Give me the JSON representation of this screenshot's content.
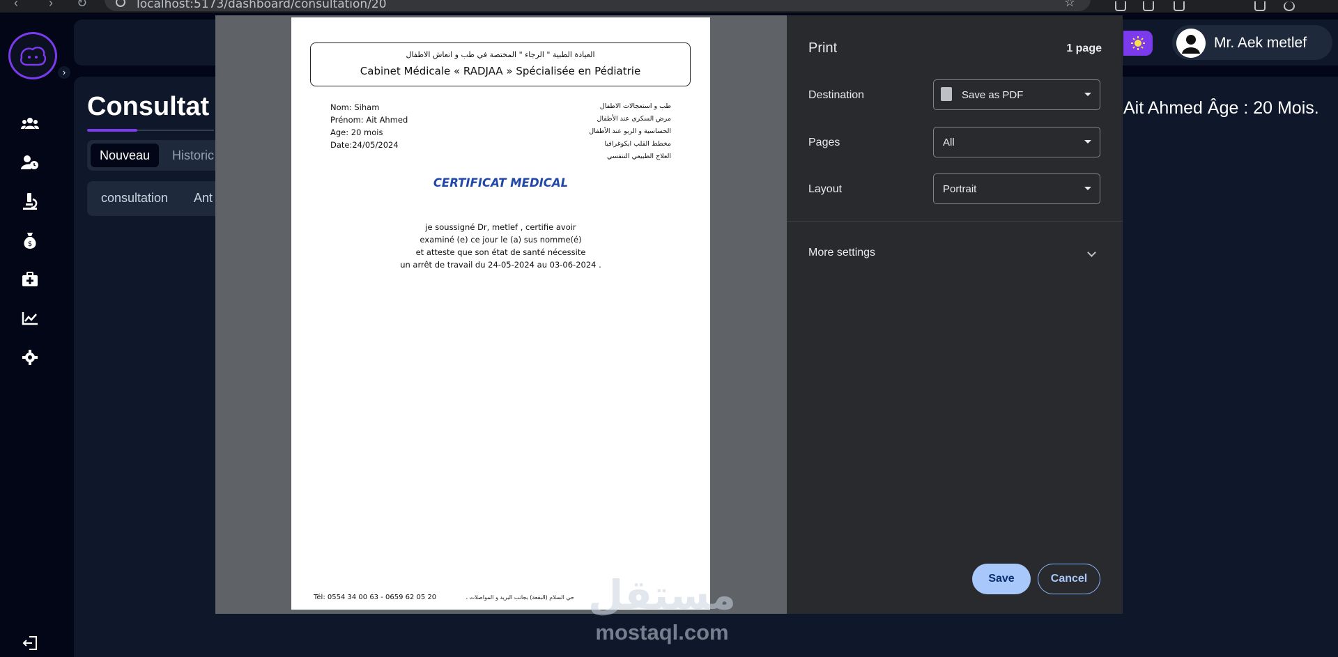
{
  "browser": {
    "url": "localhost:5173/dashboard/consultation/20"
  },
  "app": {
    "user_name": "Mr. Aek metlef",
    "page_title": "Consultat",
    "tabs": [
      "Nouveau",
      "Historic"
    ],
    "subtabs": [
      "consultation",
      "Ant"
    ],
    "patient_info": "Ait Ahmed Âge : 20 Mois.",
    "nav_icons": [
      "patients-icon",
      "user-clock-icon",
      "microscope-icon",
      "money-bag-icon",
      "medical-kit-icon",
      "chart-line-icon",
      "gear-icon"
    ],
    "accent_color": "#7c3aed"
  },
  "print": {
    "title": "Print",
    "page_count": "1 page",
    "destination_label": "Destination",
    "destination_value": "Save as PDF",
    "pages_label": "Pages",
    "pages_value": "All",
    "layout_label": "Layout",
    "layout_value": "Portrait",
    "more_settings": "More settings",
    "save_label": "Save",
    "cancel_label": "Cancel"
  },
  "document": {
    "header_ar": "العيادة الطبية \" الرجاء \" المختصة في طب و انعاش الاطفال",
    "header_fr": "Cabinet Médicale « RADJAA » Spécialisée en Pédiatrie",
    "patient_lines": [
      "Nom: Siham",
      "Prénom: Ait Ahmed",
      "Age: 20 mois",
      "Date:24/05/2024"
    ],
    "specialties_ar": [
      "طب و استعجالات الاطفال",
      "مرض السكري عند الأطفال",
      "الحساسية و الربو عند الأطفال",
      "مخطط القلب ايكوغرافيا",
      "العلاج الطبيعي التنفسي"
    ],
    "certificate_title": "CERTIFICAT MEDICAL",
    "body_lines": [
      "je soussigné Dr, metlef , certifie avoir",
      "examiné (e) ce jour le (a) sus nomme(é)",
      "et atteste que son état de santé nécessite",
      "un arrêt de travail du 24-05-2024 au 03-06-2024 ."
    ],
    "footer_tel": "Tél: 0554 34 00 63 - 0659 62 05 20",
    "footer_ar": "حي السلام (البقعة) بجانب البريد و المواصلات ،"
  },
  "watermark": {
    "text_ar": "مستقل",
    "url": "mostaql.com"
  }
}
